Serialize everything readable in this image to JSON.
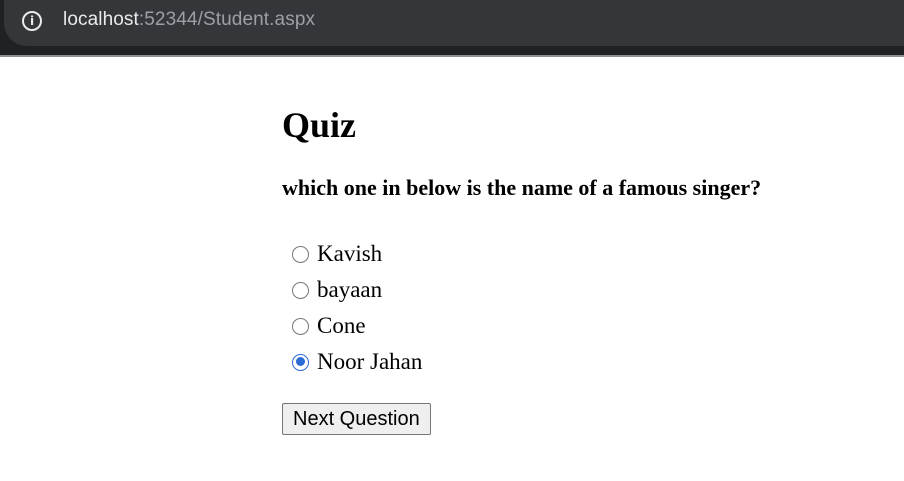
{
  "browser": {
    "url_host": "localhost",
    "url_rest": ":52344/Student.aspx",
    "info_icon": "info-circle-icon"
  },
  "page": {
    "title": "Quiz",
    "question": "which one in below is the name of a famous singer?",
    "options": [
      {
        "label": "Kavish",
        "checked": false
      },
      {
        "label": "bayaan",
        "checked": false
      },
      {
        "label": "Cone",
        "checked": false
      },
      {
        "label": "Noor Jahan",
        "checked": true
      }
    ],
    "next_button_label": "Next Question"
  },
  "colors": {
    "radio_selected": "#2a6bd6",
    "chrome_bar": "#35363a"
  }
}
